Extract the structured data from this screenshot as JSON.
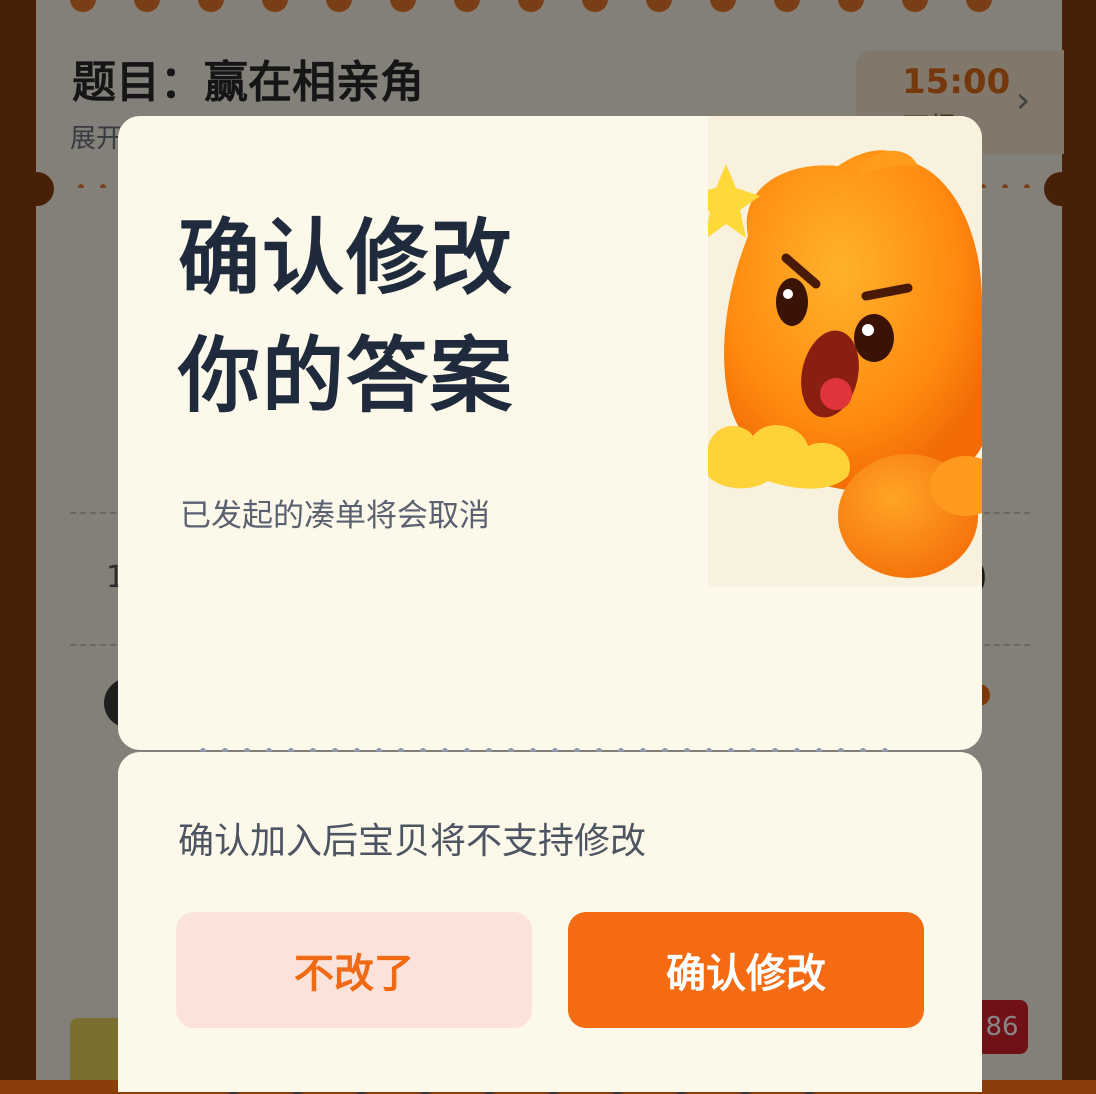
{
  "background": {
    "question_title": "题目：赢在相亲角",
    "expand_label": "展开",
    "timer": {
      "time": "15:00",
      "label": "开场"
    },
    "partial_heading_char": "",
    "partial_sub_char": "",
    "row_left_char": "1",
    "row_right_char": "0",
    "badge_number": "86"
  },
  "modal": {
    "heading_line1": "确认修改",
    "heading_line2": "你的答案",
    "description": "已发起的凑单将会取消",
    "notice": "确认加入后宝贝将不支持修改",
    "cancel_label": "不改了",
    "confirm_label": "确认修改"
  },
  "colors": {
    "accent": "#f56b13",
    "cancel_bg": "#fbe2da",
    "heading": "#1f2a3c",
    "modal_bg": "#fcf8ea"
  },
  "icons": {
    "mascot": "angry-orange-mascot-with-star",
    "chevron": "chevron-right-icon"
  }
}
